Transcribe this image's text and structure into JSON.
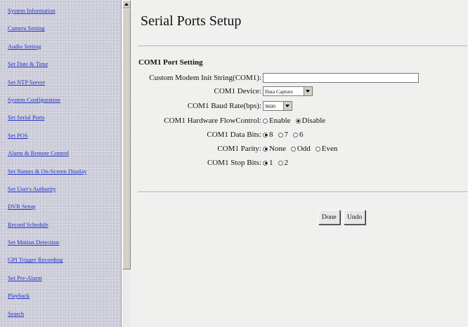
{
  "sidebar": {
    "items": [
      "System Information",
      "Camera Setting",
      "Audio Setting",
      "Set Date & Time",
      "Set NTP Server",
      "System Configuration",
      "Set Serial Ports",
      "Set POS",
      "Alarm & Remote Control",
      "Set Names & On-Screen Display",
      "Set User's Authority",
      "DVR Setup",
      "Record Schedule",
      "Set Motion Detection",
      "GPI Trigger Recording",
      "Set Pre-Alarm",
      "Playback",
      "Search"
    ]
  },
  "page": {
    "title": "Serial Ports Setup",
    "section_title": "COM1 Port Setting"
  },
  "form": {
    "modem_init": {
      "label": "Custom Modem Init String(COM1):",
      "value": ""
    },
    "device": {
      "label": "COM1 Device:",
      "value": "Data Capture"
    },
    "baud": {
      "label": "COM1 Baud Rate(bps):",
      "value": "9600"
    },
    "flow": {
      "label": "COM1 Hardware FlowControl:",
      "options": [
        "Enable",
        "Disable"
      ],
      "selected": "Disable"
    },
    "data_bits": {
      "label": "COM1 Data Bits:",
      "options": [
        "8",
        "7",
        "6"
      ],
      "selected": "8"
    },
    "parity": {
      "label": "COM1 Parity:",
      "options": [
        "None",
        "Odd",
        "Even"
      ],
      "selected": "None"
    },
    "stop_bits": {
      "label": "COM1 Stop Bits:",
      "options": [
        "1",
        "2"
      ],
      "selected": "1"
    }
  },
  "buttons": {
    "done": "Done",
    "undo": "Undo"
  },
  "colors": {
    "sidebar_link": "#2433c8",
    "sidebar_bg": "#cfd0dc"
  }
}
